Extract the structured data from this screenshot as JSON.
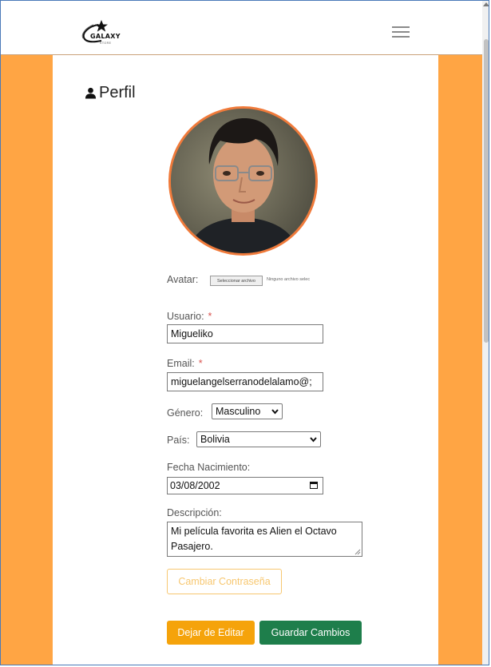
{
  "header": {
    "logo_text": "GALAXY",
    "logo_subtext": "STORE",
    "menu_icon": "hamburger-icon"
  },
  "profile": {
    "title": "Perfil",
    "title_icon": "user-icon",
    "avatar": {
      "label": "Avatar:",
      "file_button": "Seleccionar archivo",
      "file_status": "Ninguno archivo selec"
    },
    "username": {
      "label": "Usuario:",
      "required_mark": "*",
      "value": "Migueliko"
    },
    "email": {
      "label": "Email:",
      "required_mark": "*",
      "value": "miguelangelserranodelalamo@;"
    },
    "gender": {
      "label": "Género:",
      "value": "Masculino"
    },
    "country": {
      "label": "País:",
      "value": "Bolivia"
    },
    "birthdate": {
      "label": "Fecha Nacimiento:",
      "value": "03/08/2002"
    },
    "description": {
      "label": "Descripción:",
      "value": "Mi película favorita es Alien el Octavo Pasajero."
    },
    "change_password_button": "Cambiar Contraseña",
    "stop_editing_button": "Dejar de Editar",
    "save_button": "Guardar Cambios"
  },
  "colors": {
    "page_background": "#ffa544",
    "avatar_border": "#f07a3a",
    "warning_button": "#f5a30b",
    "outline_button": "#f7c770",
    "success_button": "#1e7e4b",
    "required": "#d9534f"
  }
}
